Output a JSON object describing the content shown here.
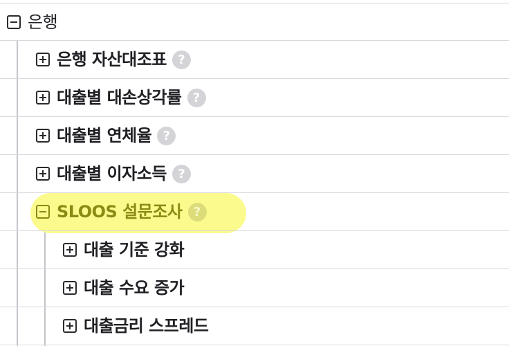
{
  "tree": {
    "root": {
      "label": "은행",
      "expanded": true,
      "toggle_icon": "minus-square-icon"
    },
    "children": [
      {
        "label": "은행 자산대조표",
        "expanded": false,
        "has_help": true
      },
      {
        "label": "대출별 대손상각률",
        "expanded": false,
        "has_help": true
      },
      {
        "label": "대출별 연체율",
        "expanded": false,
        "has_help": true
      },
      {
        "label": "대출별 이자소득",
        "expanded": false,
        "has_help": true
      },
      {
        "label": "SLOOS 설문조사",
        "expanded": true,
        "highlighted": true,
        "has_help": true,
        "children": [
          {
            "label": "대출 기준 강화",
            "expanded": false
          },
          {
            "label": "대출 수요 증가",
            "expanded": false
          },
          {
            "label": "대출금리 스프레드",
            "expanded": false
          }
        ]
      }
    ],
    "help_glyph": "?",
    "highlight_color": "#fbfa8c"
  }
}
